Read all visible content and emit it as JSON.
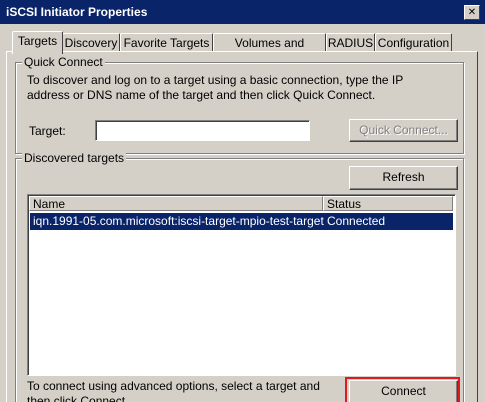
{
  "window": {
    "title": "iSCSI Initiator Properties",
    "close_glyph": "✕"
  },
  "tabs": [
    {
      "label": "Targets",
      "active": true
    },
    {
      "label": "Discovery"
    },
    {
      "label": "Favorite Targets"
    },
    {
      "label": "Volumes and Devices"
    },
    {
      "label": "RADIUS"
    },
    {
      "label": "Configuration"
    }
  ],
  "quick_connect": {
    "group_label": "Quick Connect",
    "description": "To discover and log on to a target using a basic connection, type the IP address or DNS name of the target and then click Quick Connect.",
    "target_label": "Target:",
    "target_value": "",
    "button_label": "Quick Connect..."
  },
  "discovered": {
    "group_label": "Discovered targets",
    "refresh_label": "Refresh",
    "columns": [
      "Name",
      "Status"
    ],
    "rows": [
      {
        "name": "iqn.1991-05.com.microsoft:iscsi-target-mpio-test-target",
        "status": "Connected"
      }
    ],
    "advanced_text": "To connect using advanced options, select a target and then click Connect.",
    "connect_label": "Connect",
    "highlight_color": "#e0191f"
  }
}
